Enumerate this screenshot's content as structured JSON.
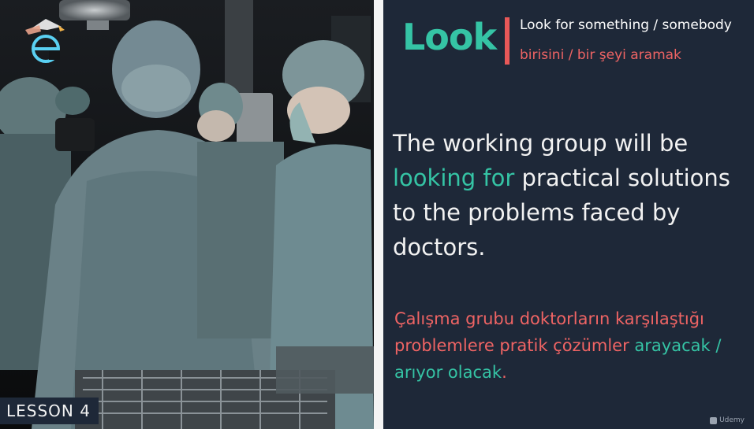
{
  "lesson": {
    "label": "LESSON 4"
  },
  "word": {
    "title": "Look",
    "definition_en": "Look for something / somebody",
    "definition_tr": "birisini / bir şeyi aramak"
  },
  "sentence_en": {
    "part1": "The working group will be ",
    "highlight": "looking for",
    "part2": " practical solutions to the problems faced by doctors."
  },
  "sentence_tr": {
    "part1": "Çalışma grubu doktorların karşılaştığı problemlere pratik çözümler ",
    "highlight": "arayacak / arıyor olacak",
    "part2": "."
  },
  "watermark": {
    "text": "Udemy"
  },
  "colors": {
    "accent_green": "#35c4a5",
    "accent_red": "#e85858",
    "panel_bg": "#1e2838"
  },
  "icons": {
    "logo": "e-logo-icon",
    "watermark": "udemy-icon"
  }
}
